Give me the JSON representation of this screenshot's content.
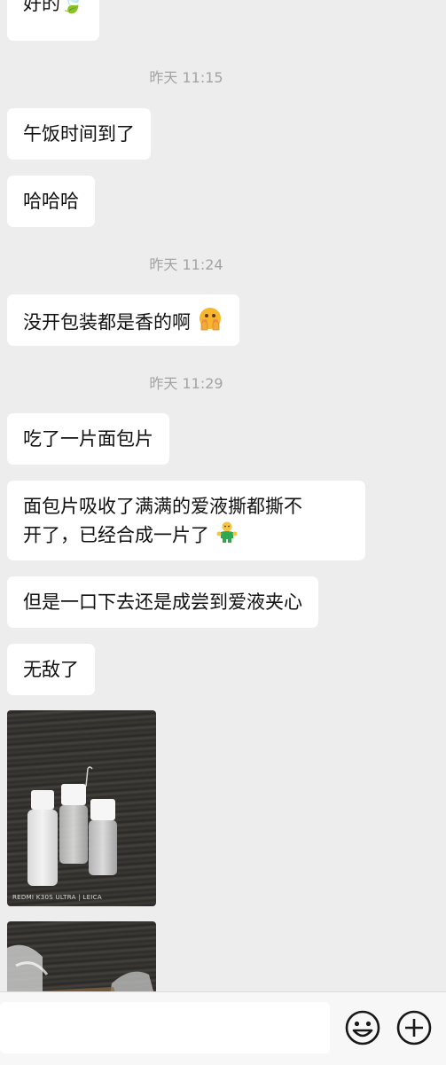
{
  "top_partial_bubble": "好的🍃",
  "timestamps": [
    "昨天 11:15",
    "昨天 11:24",
    "昨天 11:29"
  ],
  "messages": [
    {
      "text": "午饭时间到了"
    },
    {
      "text": "哈哈哈"
    },
    {
      "text": "没开包装都是香的啊",
      "emoji": "flushed-face-with-hands"
    },
    {
      "text": "吃了一片面包片"
    },
    {
      "line1": "面包片吸收了满满的爱液撕都撕不",
      "line2": "开了，已经合成一片了",
      "emoji": "hugging-figure"
    },
    {
      "text": "但是一口下去还是成尝到爱液夹心"
    },
    {
      "text": "无敌了"
    }
  ],
  "photo_watermark": "REDMI K30S ULTRA | LEICA",
  "input": {
    "value": "",
    "placeholder": ""
  },
  "icons": {
    "emoji_button": "smiley-face-icon",
    "more_button": "plus-circle-icon"
  },
  "colors": {
    "background": "#ededed",
    "bubble": "#ffffff",
    "timestamp_text": "#a3a3a3",
    "bottom_bar": "#f7f7f7"
  }
}
